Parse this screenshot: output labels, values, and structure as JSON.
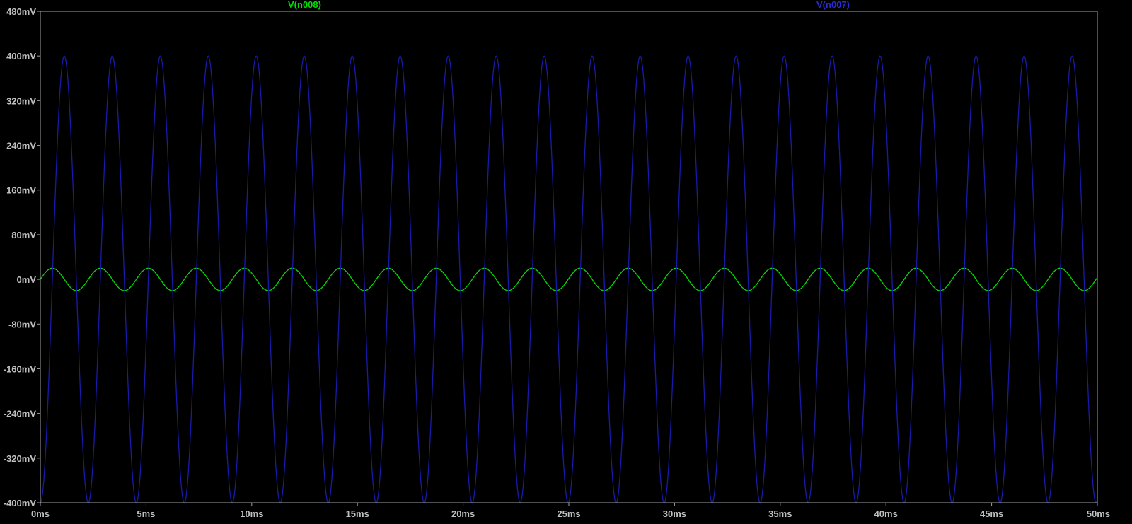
{
  "chart_data": {
    "type": "line",
    "title": "",
    "xlabel": "",
    "ylabel": "",
    "x_unit": "ms",
    "y_unit": "mV",
    "xlim": [
      0,
      50
    ],
    "ylim": [
      -400,
      480
    ],
    "x_ticks": [
      {
        "value": 0,
        "label": "0ms"
      },
      {
        "value": 5,
        "label": "5ms"
      },
      {
        "value": 10,
        "label": "10ms"
      },
      {
        "value": 15,
        "label": "15ms"
      },
      {
        "value": 20,
        "label": "20ms"
      },
      {
        "value": 25,
        "label": "25ms"
      },
      {
        "value": 30,
        "label": "30ms"
      },
      {
        "value": 35,
        "label": "35ms"
      },
      {
        "value": 40,
        "label": "40ms"
      },
      {
        "value": 45,
        "label": "45ms"
      },
      {
        "value": 50,
        "label": "50ms"
      }
    ],
    "y_ticks": [
      {
        "value": 480,
        "label": "480mV"
      },
      {
        "value": 400,
        "label": "400mV"
      },
      {
        "value": 320,
        "label": "320mV"
      },
      {
        "value": 240,
        "label": "240mV"
      },
      {
        "value": 160,
        "label": "160mV"
      },
      {
        "value": 80,
        "label": "80mV"
      },
      {
        "value": 0,
        "label": "0mV"
      },
      {
        "value": -80,
        "label": "-80mV"
      },
      {
        "value": -160,
        "label": "-160mV"
      },
      {
        "value": -240,
        "label": "-240mV"
      },
      {
        "value": -320,
        "label": "-320mV"
      },
      {
        "value": -400,
        "label": "-400mV"
      }
    ],
    "grid": false,
    "legend_position": "top",
    "series": [
      {
        "name": "V(n008)",
        "color": "#00dd00",
        "waveform": "sine",
        "amplitude_mV": 20,
        "offset_mV": 0,
        "period_ms": 2.27,
        "phase_ms": 0
      },
      {
        "name": "V(n007)",
        "color": "#1a1aa8",
        "waveform": "sine",
        "amplitude_mV": 400,
        "offset_mV": 0,
        "period_ms": 2.27,
        "phase_ms": 0.567
      }
    ]
  }
}
